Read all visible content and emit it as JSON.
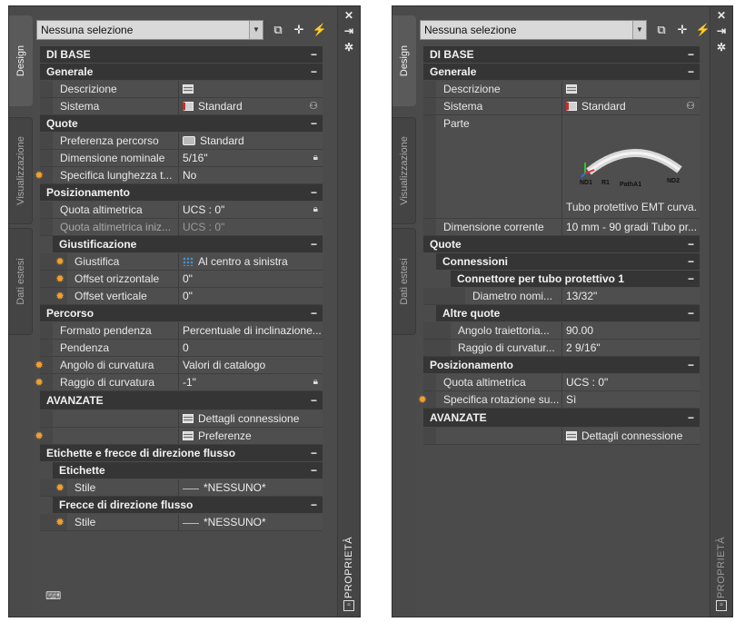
{
  "left": {
    "tabs": [
      "Design",
      "Visualizzazione",
      "Dati estesi"
    ],
    "dropdown": "Nessuna selezione",
    "strip_title": "PROPRIETÀ",
    "sections": {
      "base": "DI BASE",
      "generale": "Generale",
      "quote": "Quote",
      "posizionamento": "Posizionamento",
      "giustificazione": "Giustificazione",
      "percorso": "Percorso",
      "avanzate": "AVANZATE",
      "etichette_frecce": "Etichette e frecce di direzione flusso",
      "etichette": "Etichette",
      "frecce": "Frecce di direzione flusso"
    },
    "props": {
      "descrizione": {
        "label": "Descrizione",
        "value": ""
      },
      "sistema": {
        "label": "Sistema",
        "value": "Standard"
      },
      "preferenza": {
        "label": "Preferenza percorso",
        "value": "Standard"
      },
      "dimensione": {
        "label": "Dimensione nominale",
        "value": "5/16\""
      },
      "specifica": {
        "label": "Specifica lunghezza t...",
        "value": "No"
      },
      "quota_alt": {
        "label": "Quota altimetrica",
        "value": "UCS : 0\""
      },
      "quota_iniz": {
        "label": "Quota altimetrica iniz...",
        "value": "UCS : 0\""
      },
      "giustifica": {
        "label": "Giustifica",
        "value": "Al centro a sinistra"
      },
      "offset_or": {
        "label": "Offset orizzontale",
        "value": "0\""
      },
      "offset_ve": {
        "label": "Offset verticale",
        "value": "0\""
      },
      "formato": {
        "label": "Formato pendenza",
        "value": "Percentuale di inclinazione..."
      },
      "pendenza": {
        "label": "Pendenza",
        "value": "0"
      },
      "angolo": {
        "label": "Angolo di curvatura",
        "value": "Valori di catalogo"
      },
      "raggio": {
        "label": "Raggio di curvatura",
        "value": "-1\""
      },
      "dettagli": {
        "value": "Dettagli connessione"
      },
      "preferenze": {
        "value": "Preferenze"
      },
      "stile1": {
        "label": "Stile",
        "value": "*NESSUNO*"
      },
      "stile2": {
        "label": "Stile",
        "value": "*NESSUNO*"
      }
    }
  },
  "right": {
    "tabs": [
      "Design",
      "Visualizzazione",
      "Dati estesi"
    ],
    "dropdown": "Nessuna selezione",
    "strip_title": "PROPRIETÀ",
    "sections": {
      "base": "DI BASE",
      "generale": "Generale",
      "quote": "Quote",
      "connessioni": "Connessioni",
      "connettore": "Connettore per tubo protettivo 1",
      "altre": "Altre quote",
      "posizionamento": "Posizionamento",
      "avanzate": "AVANZATE"
    },
    "props": {
      "descrizione": {
        "label": "Descrizione",
        "value": ""
      },
      "sistema": {
        "label": "Sistema",
        "value": "Standard"
      },
      "parte": {
        "label": "Parte",
        "value": "Tubo protettivo EMT curva..."
      },
      "dim_corrente": {
        "label": "Dimensione corrente",
        "value": "10 mm - 90 gradi Tubo pr..."
      },
      "diametro": {
        "label": "Diametro nomi...",
        "value": "13/32\""
      },
      "angolo": {
        "label": "Angolo traiettoria...",
        "value": "90.00"
      },
      "raggio": {
        "label": "Raggio di curvatur...",
        "value": "2 9/16\""
      },
      "quota_alt": {
        "label": "Quota altimetrica",
        "value": "UCS : 0\""
      },
      "specifica_rot": {
        "label": "Specifica rotazione su...",
        "value": "Sì"
      },
      "dettagli": {
        "value": "Dettagli connessione"
      }
    },
    "preview_labels": {
      "nd1": "ND1",
      "r1": "R1",
      "path": "PathA1",
      "nd2": "ND2"
    }
  },
  "colors": {
    "panel": "#4b4b4b",
    "header": "#353535",
    "accent_star": "#f0a030"
  }
}
